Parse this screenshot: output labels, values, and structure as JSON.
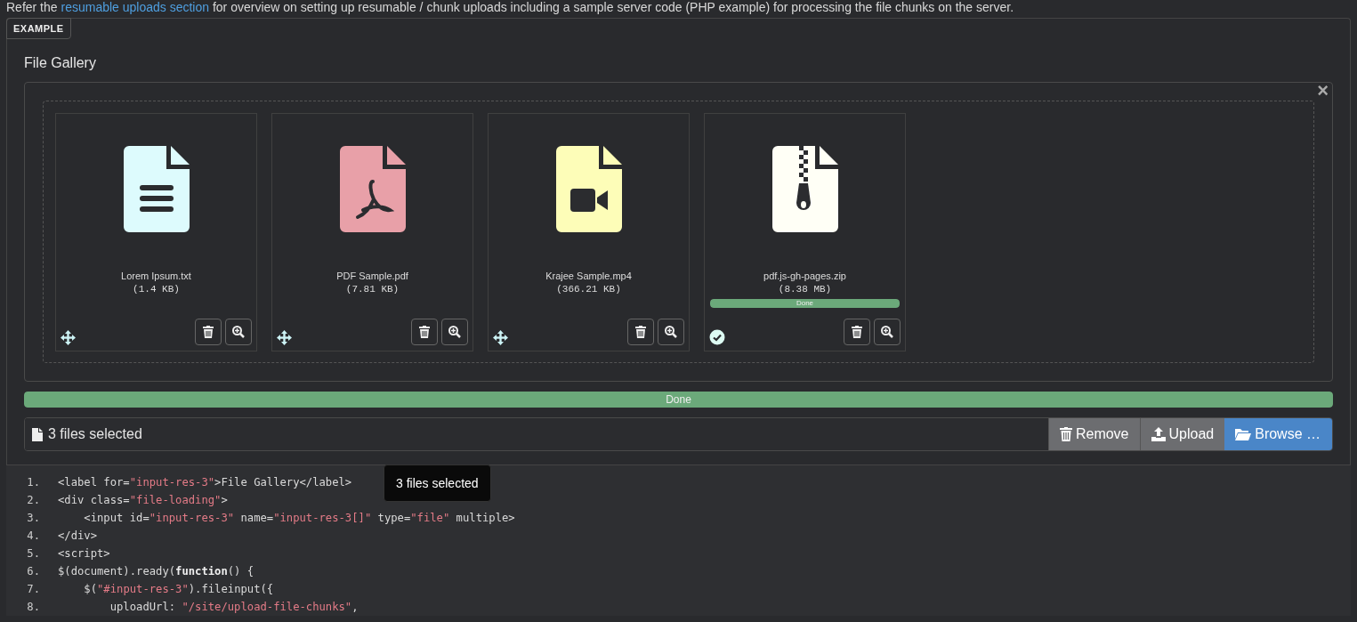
{
  "intro": {
    "before": "Refer the ",
    "link": "resumable uploads section",
    "after": " for overview on setting up resumable / chunk uploads including a sample server code (PHP example) for processing the file chunks on the server."
  },
  "example": {
    "tab": "EXAMPLE",
    "label": "File Gallery",
    "close": "×",
    "files": [
      {
        "name": "Lorem Ipsum.txt",
        "size": "(1.4 KB)",
        "kind": "text",
        "color": "#ddfbfd",
        "uploaded": false
      },
      {
        "name": "PDF Sample.pdf",
        "size": "(7.81 KB)",
        "kind": "pdf",
        "color": "#e8a0a8",
        "uploaded": false
      },
      {
        "name": "Krajee Sample.mp4",
        "size": "(366.21 KB)",
        "kind": "video",
        "color": "#fdfdb8",
        "uploaded": false
      },
      {
        "name": "pdf.js-gh-pages.zip",
        "size": "(8.38 MB)",
        "kind": "zip",
        "color": "#fffff6",
        "uploaded": true,
        "progress": {
          "level": 1,
          "label": "Done"
        }
      }
    ],
    "progress": {
      "level": 1,
      "label": "Done"
    },
    "caption": "3 files selected",
    "buttons": [
      {
        "label": "Remove",
        "kind": "remove"
      },
      {
        "label": "Upload",
        "kind": "upload"
      },
      {
        "label": "Browse …",
        "kind": "browse"
      }
    ],
    "tooltip": "3 files selected"
  },
  "code": [
    {
      "num": "1.",
      "tokens": [
        {
          "kind": "t",
          "t": "<label for="
        },
        {
          "kind": "s",
          "t": "\"input-res-3\""
        },
        {
          "kind": "t",
          "t": ">File Gallery</label>"
        }
      ]
    },
    {
      "num": "2.",
      "tokens": [
        {
          "kind": "t",
          "t": "<div class="
        },
        {
          "kind": "s",
          "t": "\"file-loading\""
        },
        {
          "kind": "t",
          "t": ">"
        }
      ]
    },
    {
      "num": "3.",
      "tokens": [
        {
          "kind": "t",
          "t": "    <input id="
        },
        {
          "kind": "s",
          "t": "\"input-res-3\""
        },
        {
          "kind": "t",
          "t": " name="
        },
        {
          "kind": "s",
          "t": "\"input-res-3[]\""
        },
        {
          "kind": "t",
          "t": " type="
        },
        {
          "kind": "s",
          "t": "\"file\""
        },
        {
          "kind": "t",
          "t": " multiple>"
        }
      ]
    },
    {
      "num": "4.",
      "tokens": [
        {
          "kind": "t",
          "t": "</div>"
        }
      ]
    },
    {
      "num": "5.",
      "tokens": [
        {
          "kind": "t",
          "t": "<script>"
        }
      ]
    },
    {
      "num": "6.",
      "tokens": [
        {
          "kind": "t",
          "t": "$(document).ready("
        },
        {
          "kind": "kw",
          "t": "function"
        },
        {
          "kind": "t",
          "t": "() {"
        }
      ]
    },
    {
      "num": "7.",
      "tokens": [
        {
          "kind": "t",
          "t": "    $("
        },
        {
          "kind": "s",
          "t": "\"#input-res-3\""
        },
        {
          "kind": "t",
          "t": ").fileinput({"
        }
      ]
    },
    {
      "num": "8.",
      "tokens": [
        {
          "kind": "t",
          "t": "        uploadUrl: "
        },
        {
          "kind": "s",
          "t": "\"/site/upload-file-chunks\""
        },
        {
          "kind": "t",
          "t": ","
        }
      ]
    }
  ]
}
